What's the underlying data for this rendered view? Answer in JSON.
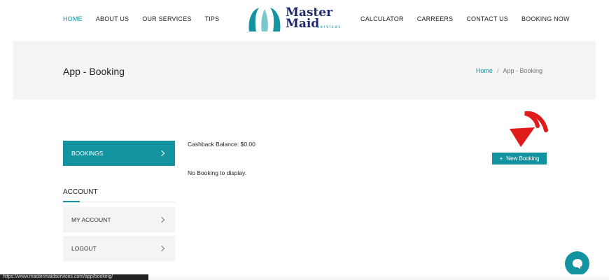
{
  "nav": {
    "left": [
      {
        "label": "HOME"
      },
      {
        "label": "ABOUT US"
      },
      {
        "label": "OUR SERVICES"
      },
      {
        "label": "TIPS"
      }
    ],
    "right": [
      {
        "label": "CALCULATOR"
      },
      {
        "label": "CARREERS"
      },
      {
        "label": "CONTACT US"
      },
      {
        "label": "BOOKING NOW"
      }
    ]
  },
  "logo": {
    "line1": "Master",
    "line2": "Maid",
    "sub": "services"
  },
  "page": {
    "title": "App - Booking",
    "breadcrumb_home": "Home",
    "breadcrumb_sep": "/",
    "breadcrumb_current": "App - Booking"
  },
  "sidebar": {
    "active_label": "BOOKINGS",
    "account_heading": "ACCOUNT",
    "items": [
      {
        "label": "MY ACCOUNT"
      },
      {
        "label": "LOGOUT"
      }
    ]
  },
  "main": {
    "cashback": "Cashback Balance: $0.00",
    "empty": "No Booking to display.",
    "new_booking_icon": "+",
    "new_booking_label": "New Booking"
  },
  "colors": {
    "accent": "#1393a0",
    "brand_navy": "#1f2a6e",
    "arrow": "#e01b1b"
  },
  "status_url": "https://www.mastermaidservices.com/app/booking/"
}
